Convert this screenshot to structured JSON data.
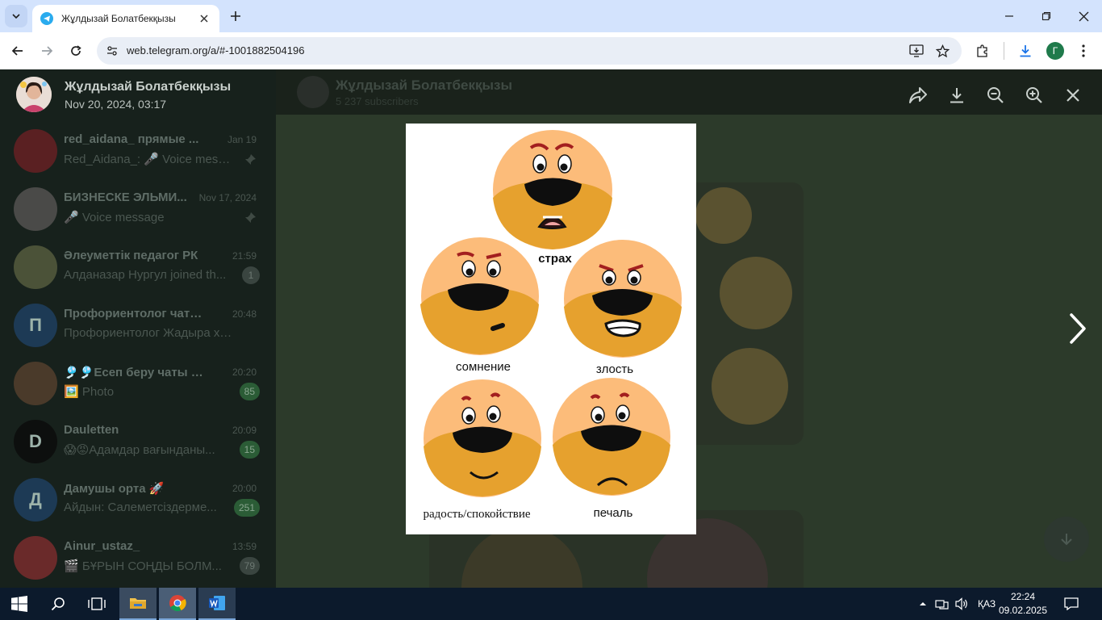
{
  "browser": {
    "tab_title": "Жұлдызай Болатбекқызы",
    "url": "web.telegram.org/a/#-1001882504196",
    "profile_initial": "Г"
  },
  "viewer": {
    "sender_name": "Жұлдызай Болатбекқызы",
    "date": "Nov 20, 2024, 03:17",
    "photo_labels": {
      "fear": "страх",
      "doubt": "сомнение",
      "anger": "злость",
      "joy": "радость/спокойствие",
      "sadness": "печаль"
    }
  },
  "channel_header": {
    "title": "Жұлдызай Болатбекқызы",
    "subtitle": "5 237 subscribers"
  },
  "chats": [
    {
      "name": "red_aidana_ прямые ...",
      "time": "Jan 19",
      "message": "Red_Aidana_: 🎤 Voice mess...",
      "badge": "",
      "pinned": true,
      "avatar_letter": "",
      "avatar_color": "#5a2022"
    },
    {
      "name": "БИЗНЕСКЕ ЭЛЬМИ...",
      "time": "Nov 17, 2024",
      "message": "🎤 Voice message",
      "badge": "",
      "pinned": true,
      "avatar_letter": "",
      "avatar_color": "#4a4a48"
    },
    {
      "name": "Әлеуметтік педагог РК",
      "time": "21:59",
      "message": "Алданазар Нургул joined th...",
      "badge": "1",
      "muted": true,
      "avatar_letter": "",
      "avatar_color": "#4b5238"
    },
    {
      "name": "Профориентолог чат \"Фо...",
      "time": "20:48",
      "message": "Профориентолог Жадыра хан...",
      "badge": "",
      "avatar_letter": "П",
      "avatar_color": "#1d3a55"
    },
    {
      "name": "🎐🎐Есеп беру чаты 🎐",
      "time": "20:20",
      "message": "🖼️ Photo",
      "badge": "85",
      "avatar_letter": "",
      "avatar_color": "#4a3a2a"
    },
    {
      "name": "Dauletten",
      "time": "20:09",
      "message": "😱😡Адамдар вағынданы...",
      "badge": "15",
      "avatar_letter": "D",
      "avatar_color": "#0d0f0e"
    },
    {
      "name": "Дамушы орта 🚀",
      "time": "20:00",
      "message": "Айдын: Салеметсіздерме...",
      "badge": "251",
      "avatar_letter": "Д",
      "avatar_color": "#1d3a55"
    },
    {
      "name": "Ainur_ustaz_",
      "time": "13:59",
      "message": "🎬 БҰРЫН СОҢДЫ БОЛМ...",
      "badge": "79",
      "muted": true,
      "avatar_letter": "",
      "avatar_color": "#6a2a2a"
    }
  ],
  "taskbar": {
    "language": "ҚАЗ",
    "time": "22:24",
    "date": "09.02.2025"
  }
}
